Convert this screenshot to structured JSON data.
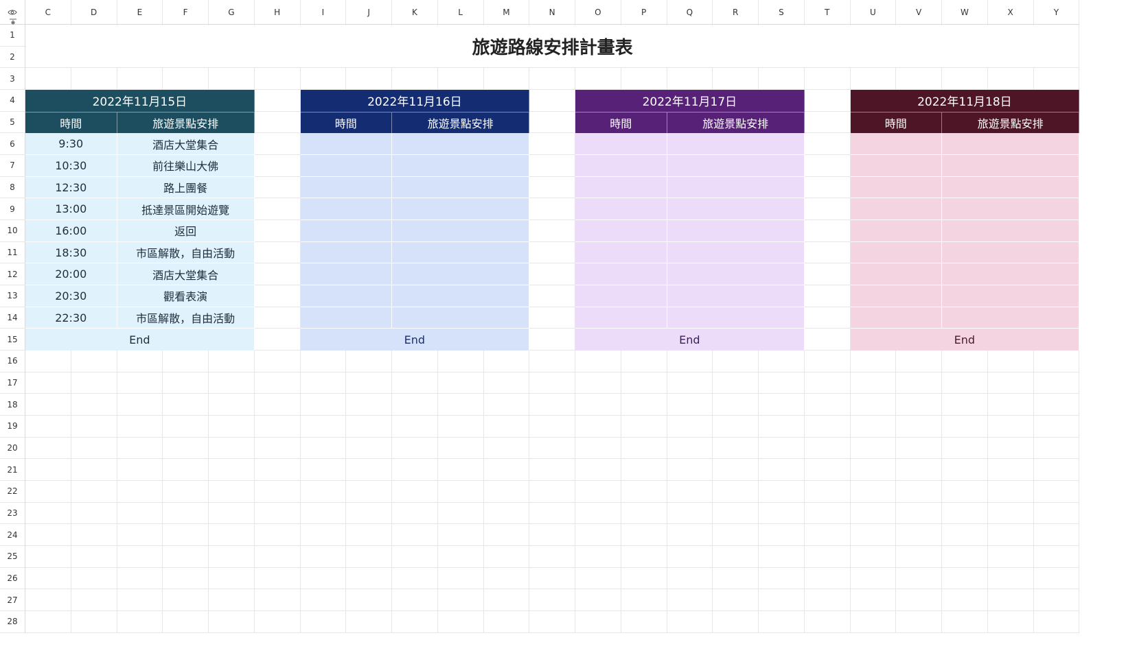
{
  "columns": [
    "C",
    "D",
    "E",
    "F",
    "G",
    "H",
    "I",
    "J",
    "K",
    "L",
    "M",
    "N",
    "O",
    "P",
    "Q",
    "R",
    "S",
    "T",
    "U",
    "V",
    "W",
    "X",
    "Y"
  ],
  "rows": [
    "1",
    "2",
    "3",
    "4",
    "5",
    "6",
    "7",
    "8",
    "9",
    "10",
    "11",
    "12",
    "13",
    "14",
    "15",
    "16",
    "17",
    "18",
    "19",
    "20",
    "21",
    "22",
    "23",
    "24",
    "25",
    "26",
    "27",
    "28"
  ],
  "title": "旅遊路線安排計畫表",
  "days": [
    {
      "date": "2022年11月15日",
      "time_header": "時間",
      "activity_header": "旅遊景點安排",
      "header_color": "#1d4e5f",
      "body_color": "#e0f2fb",
      "text_color": "#1f2d3d",
      "schedule": [
        {
          "time": "9:30",
          "activity": "酒店大堂集合"
        },
        {
          "time": "10:30",
          "activity": "前往樂山大佛"
        },
        {
          "time": "12:30",
          "activity": "路上團餐"
        },
        {
          "time": "13:00",
          "activity": "抵達景區開始遊覽"
        },
        {
          "time": "16:00",
          "activity": "返回"
        },
        {
          "time": "18:30",
          "activity": "市區解散，自由活動"
        },
        {
          "time": "20:00",
          "activity": "酒店大堂集合"
        },
        {
          "time": "20:30",
          "activity": "觀看表演"
        },
        {
          "time": "22:30",
          "activity": "市區解散，自由活動"
        }
      ],
      "end_label": "End"
    },
    {
      "date": "2022年11月16日",
      "time_header": "時間",
      "activity_header": "旅遊景點安排",
      "header_color": "#142c72",
      "body_color": "#d6e2f9",
      "text_color": "#1c2f6b",
      "schedule": [
        {
          "time": "",
          "activity": ""
        },
        {
          "time": "",
          "activity": ""
        },
        {
          "time": "",
          "activity": ""
        },
        {
          "time": "",
          "activity": ""
        },
        {
          "time": "",
          "activity": ""
        },
        {
          "time": "",
          "activity": ""
        },
        {
          "time": "",
          "activity": ""
        },
        {
          "time": "",
          "activity": ""
        },
        {
          "time": "",
          "activity": ""
        }
      ],
      "end_label": "End"
    },
    {
      "date": "2022年11月17日",
      "time_header": "時間",
      "activity_header": "旅遊景點安排",
      "header_color": "#572178",
      "body_color": "#eddcf9",
      "text_color": "#3c1c5c",
      "schedule": [
        {
          "time": "",
          "activity": ""
        },
        {
          "time": "",
          "activity": ""
        },
        {
          "time": "",
          "activity": ""
        },
        {
          "time": "",
          "activity": ""
        },
        {
          "time": "",
          "activity": ""
        },
        {
          "time": "",
          "activity": ""
        },
        {
          "time": "",
          "activity": ""
        },
        {
          "time": "",
          "activity": ""
        },
        {
          "time": "",
          "activity": ""
        }
      ],
      "end_label": "End"
    },
    {
      "date": "2022年11月18日",
      "time_header": "時間",
      "activity_header": "旅遊景點安排",
      "header_color": "#4d1525",
      "body_color": "#f4d4e0",
      "text_color": "#4a1a2a",
      "schedule": [
        {
          "time": "",
          "activity": ""
        },
        {
          "time": "",
          "activity": ""
        },
        {
          "time": "",
          "activity": ""
        },
        {
          "time": "",
          "activity": ""
        },
        {
          "time": "",
          "activity": ""
        },
        {
          "time": "",
          "activity": ""
        },
        {
          "time": "",
          "activity": ""
        },
        {
          "time": "",
          "activity": ""
        },
        {
          "time": "",
          "activity": ""
        }
      ],
      "end_label": "End"
    }
  ],
  "icons": {
    "corner_top": "eye-icon",
    "corner_bottom": "freeze-panes-icon"
  }
}
